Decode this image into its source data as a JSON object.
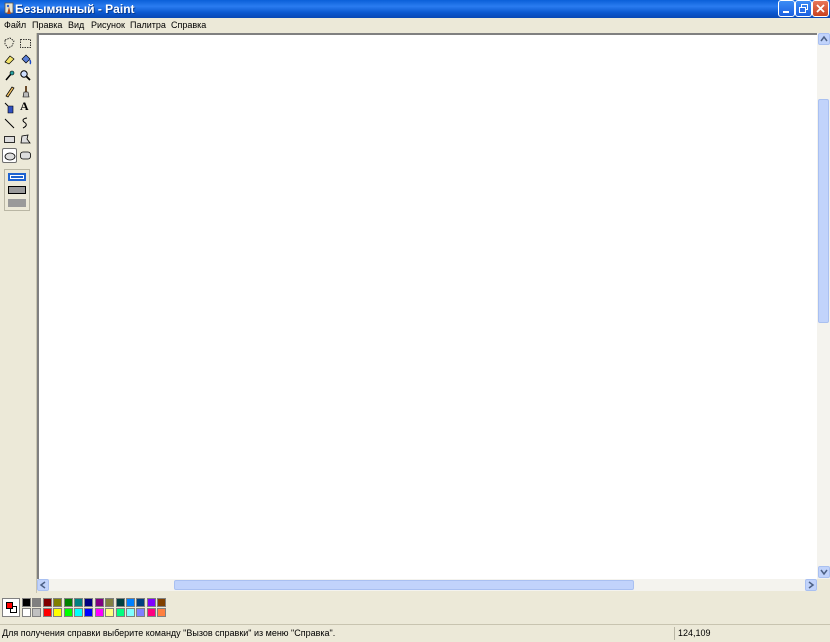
{
  "window": {
    "title": "Безымянный - Paint",
    "icon": "paint-app-icon",
    "controls": [
      "minimize-icon",
      "restore-icon",
      "close-icon"
    ]
  },
  "menu": {
    "items": [
      "Файл",
      "Правка",
      "Вид",
      "Рисунок",
      "Палитра",
      "Справка"
    ]
  },
  "toolbox": {
    "tools": [
      "free-form-select-icon",
      "select-icon",
      "eraser-icon",
      "fill-icon",
      "pick-color-icon",
      "magnifier-icon",
      "pencil-icon",
      "brush-icon",
      "airbrush-icon",
      "text-icon",
      "line-icon",
      "curve-icon",
      "rectangle-icon",
      "polygon-icon",
      "ellipse-icon",
      "rounded-rectangle-icon"
    ],
    "active_tool": "ellipse-icon",
    "text_tool_glyph": "A"
  },
  "palette": {
    "foreground": "#ff0000",
    "background": "#ffffff",
    "colors_top": [
      "#000000",
      "#808080",
      "#800000",
      "#808000",
      "#008000",
      "#008080",
      "#000080",
      "#800080",
      "#808040",
      "#004040",
      "#0080ff",
      "#004080",
      "#8000ff",
      "#804000"
    ],
    "colors_bottom": [
      "#ffffff",
      "#c0c0c0",
      "#ff0000",
      "#ffff00",
      "#00ff00",
      "#00ffff",
      "#0000ff",
      "#ff00ff",
      "#ffff80",
      "#00ff80",
      "#80ffff",
      "#8080ff",
      "#ff0080",
      "#ff8040"
    ]
  },
  "status": {
    "text": "Для получения справки выберите команду \"Вызов справки\" из меню \"Справка\".",
    "coords": "124,109"
  }
}
